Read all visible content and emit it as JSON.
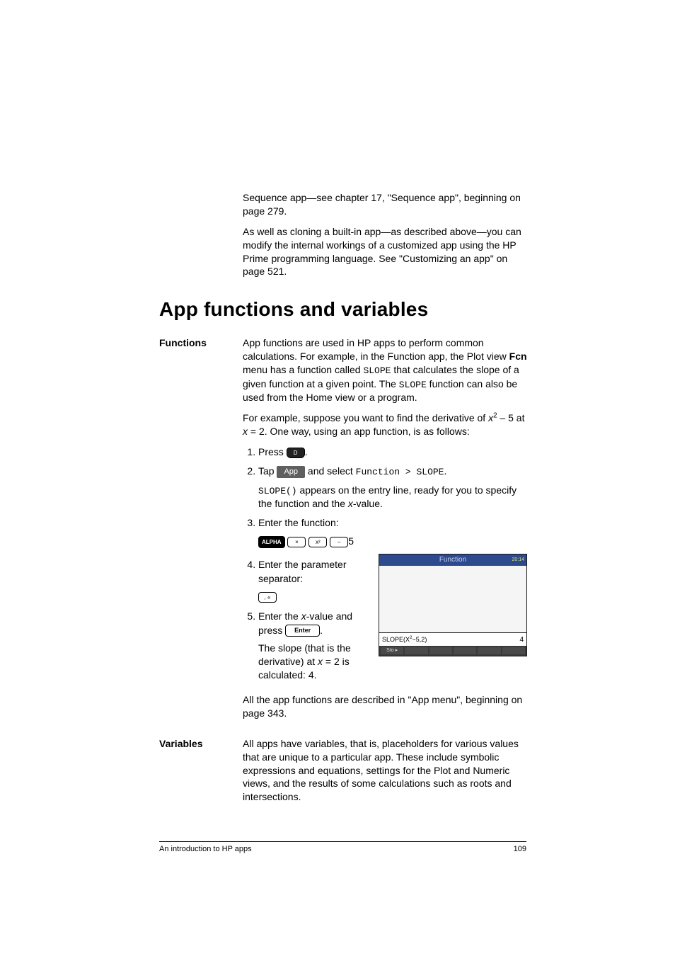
{
  "intro": {
    "p1a": "Sequence app—see chapter 17, \"Sequence app\", beginning on page 279.",
    "p2": "As well as cloning a built-in app—as described above—you can modify the internal workings of a customized app using the HP Prime programming language. See \"Customizing an app\" on page 521."
  },
  "heading": "App functions and variables",
  "functions": {
    "label": "Functions",
    "p1_a": "App functions are used in HP apps to perform common calculations. For example, in the Function app, the Plot view ",
    "p1_bold": "Fcn",
    "p1_b": " menu has a function called ",
    "p1_mono1": "SLOPE",
    "p1_c": " that calculates the slope of a given function at a given point. The ",
    "p1_mono2": "SLOPE",
    "p1_d": " function can also be used from the Home view or a program.",
    "p2_a": "For example, suppose you want to find the derivative of ",
    "p2_expr_x": "x",
    "p2_expr_rest": " – 5 at ",
    "p2_b_x": "x",
    "p2_b": " = 2. One way, using an app function, is as follows:",
    "steps": {
      "s1_a": "Press ",
      "s1_key": "D",
      "s1_b": ".",
      "s2_a": "Tap ",
      "s2_soft": "App",
      "s2_b": " and select ",
      "s2_mono": "Function > SLOPE",
      "s2_c": ".",
      "s2_sub_mono": "SLOPE()",
      "s2_sub_a": " appears on the entry line, ready for you to specify the function and the ",
      "s2_sub_x": "x",
      "s2_sub_b": "-value.",
      "s3": "Enter the function:",
      "s3_k_alpha": "ALPHA",
      "s3_k1": "×",
      "s3_k2": "x²",
      "s3_k3": "−",
      "s3_tail": "5",
      "s4": "Enter the parameter separator:",
      "s4_k": ", «",
      "s5_a": "Enter the ",
      "s5_x": "x",
      "s5_b": "-value and press ",
      "s5_key": "Enter",
      "s5_c": ".",
      "s5_sub_a": "The slope (that is the derivative) at ",
      "s5_sub_x": "x",
      "s5_sub_b": " = 2 is calculated: 4."
    },
    "closer": "All the app functions are described in \"App menu\", beginning on page 343."
  },
  "screenshot": {
    "title": "Function",
    "time": "20:14",
    "entry_expr": "SLOPE(X²−5,2)",
    "entry_sup_pre": "SLOPE",
    "entry_x": "X",
    "entry_after": "−5,2",
    "result": "4",
    "soft1": "Sto ▸"
  },
  "variables": {
    "label": "Variables",
    "p1": "All apps have variables, that is, placeholders for various values that are unique to a particular app. These include symbolic expressions and equations, settings for the Plot and Numeric views, and the results of some calculations such as roots and intersections."
  },
  "footer": {
    "left": "An introduction to HP apps",
    "right": "109"
  }
}
